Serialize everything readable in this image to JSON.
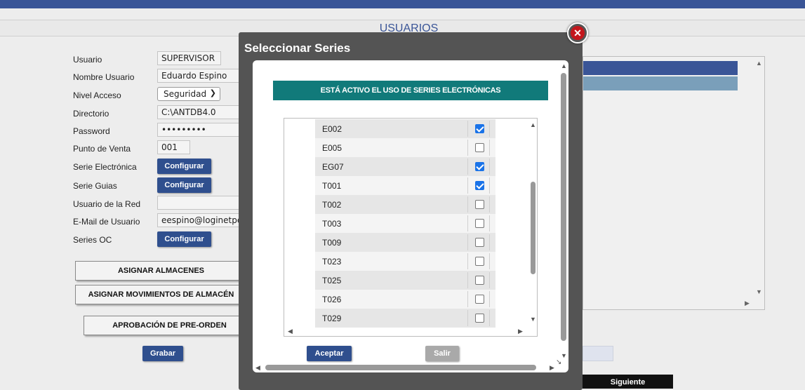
{
  "page": {
    "title": "USUARIOS"
  },
  "form": {
    "usuario": {
      "label": "Usuario",
      "value": "SUPERVISOR"
    },
    "nombre": {
      "label": "Nombre Usuario",
      "value": "Eduardo Espino"
    },
    "nivel": {
      "label": "Nivel Acceso",
      "value": "Seguridad"
    },
    "directorio": {
      "label": "Directorio",
      "value": "C:\\ANTDB4.0"
    },
    "password": {
      "label": "Password",
      "value": "•••••••••"
    },
    "punto_venta": {
      "label": "Punto de Venta",
      "value": "001"
    },
    "serie_electronica": {
      "label": "Serie Electrónica",
      "button": "Configurar"
    },
    "serie_guias": {
      "label": "Serie Guias",
      "button": "Configurar"
    },
    "usuario_red": {
      "label": "Usuario de la Red",
      "value": ""
    },
    "email": {
      "label": "E-Mail de Usuario",
      "value": "eespino@loginetperu"
    },
    "series_oc": {
      "label": "Series OC",
      "button": "Configurar"
    }
  },
  "actions": {
    "asignar_almacenes": "ASIGNAR ALMACENES",
    "asignar_movimientos": "ASIGNAR MOVIMIENTOS DE ALMACÉN",
    "aprobacion": "APROBACIÓN DE PRE-ORDEN",
    "grabar": "Grabar",
    "siguiente": "Siguiente"
  },
  "modal": {
    "title": "Seleccionar Series",
    "banner": "ESTÁ ACTIVO EL USO DE SERIES ELECTRÓNICAS",
    "series": [
      {
        "code": "E002",
        "checked": true
      },
      {
        "code": "E005",
        "checked": false
      },
      {
        "code": "EG07",
        "checked": true
      },
      {
        "code": "T001",
        "checked": true
      },
      {
        "code": "T002",
        "checked": false
      },
      {
        "code": "T003",
        "checked": false
      },
      {
        "code": "T009",
        "checked": false
      },
      {
        "code": "T023",
        "checked": false
      },
      {
        "code": "T025",
        "checked": false
      },
      {
        "code": "T026",
        "checked": false
      },
      {
        "code": "T029",
        "checked": false
      }
    ],
    "aceptar": "Aceptar",
    "salir": "Salir",
    "close_icon": "close-icon"
  },
  "colors": {
    "header": "#3a5597",
    "banner": "#117a7a",
    "close": "#c4161c"
  }
}
